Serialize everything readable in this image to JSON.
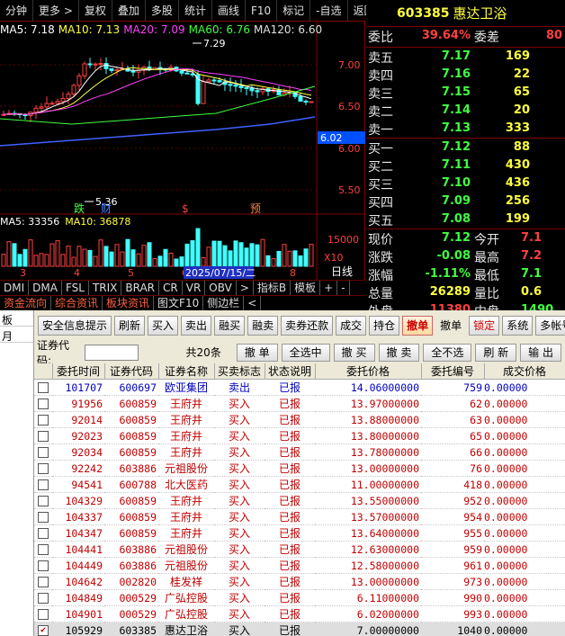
{
  "chart_toolbar": [
    "分钟",
    "更多 >",
    "复权",
    "叠加",
    "多股",
    "统计",
    "画线",
    "F10",
    "标记",
    "-自选",
    "返回"
  ],
  "ma_legend": [
    {
      "text": "MA5: 7.18",
      "color": "#ffffff"
    },
    {
      "text": "MA10: 7.13",
      "color": "#ffff40"
    },
    {
      "text": "MA20: 7.09",
      "color": "#ff40ff"
    },
    {
      "text": "MA60: 6.76",
      "color": "#40ff40"
    },
    {
      "text": "MA120: 6.60",
      "color": "#e0e0e0"
    }
  ],
  "vol_legend": [
    {
      "text": "MA5: 33356",
      "color": "#ffffff"
    },
    {
      "text": "MA10: 36878",
      "color": "#ffff40"
    }
  ],
  "chart_labels": {
    "high_marker": "7.29",
    "low_marker": "5.36",
    "price_tag": "6.02",
    "axis_ticks": [
      "7.00",
      "6.50",
      "6.00",
      "5.50"
    ],
    "vol_tick": "15000",
    "vol_unit": "X10",
    "date_tag": "2025/07/15/二",
    "day_label": "日线",
    "x_numbers": [
      "3",
      "4",
      "5",
      "6",
      "7",
      "8"
    ],
    "events": [
      {
        "text": "跌",
        "color": "#40ff40"
      },
      {
        "text": "财",
        "color": "#4080ff"
      },
      {
        "text": "$",
        "color": "#ff4040"
      },
      {
        "text": "预",
        "color": "#ff8040"
      }
    ]
  },
  "indicator_tabs": [
    "DMI",
    "DMA",
    "FSL",
    "TRIX",
    "BRAR",
    "CR",
    "VR",
    "OBV",
    ">",
    "指标B",
    "模板",
    "+",
    "-"
  ],
  "sub_tabs": [
    "资金流向",
    "综合资讯",
    "板块资讯",
    "图文F10",
    "侧边栏",
    "<"
  ],
  "quote": {
    "code": "603385",
    "name": "惠达卫浴",
    "weibi_label": "委比",
    "weibi": "39.64%",
    "weicha_label": "委差",
    "weicha": "80",
    "asks": [
      {
        "label": "卖五",
        "price": "7.17",
        "vol": "169"
      },
      {
        "label": "卖四",
        "price": "7.16",
        "vol": "22"
      },
      {
        "label": "卖三",
        "price": "7.15",
        "vol": "65"
      },
      {
        "label": "卖二",
        "price": "7.14",
        "vol": "20"
      },
      {
        "label": "卖一",
        "price": "7.13",
        "vol": "333"
      }
    ],
    "bids": [
      {
        "label": "买一",
        "price": "7.12",
        "vol": "88"
      },
      {
        "label": "买二",
        "price": "7.11",
        "vol": "430"
      },
      {
        "label": "买三",
        "price": "7.10",
        "vol": "436"
      },
      {
        "label": "买四",
        "price": "7.09",
        "vol": "256"
      },
      {
        "label": "买五",
        "price": "7.08",
        "vol": "199"
      }
    ],
    "stats": [
      {
        "l1": "现价",
        "v1": "7.12",
        "c1": "#40ff40",
        "l2": "今开",
        "v2": "7.1",
        "c2": "#ff4040"
      },
      {
        "l1": "涨跌",
        "v1": "-0.08",
        "c1": "#40ff40",
        "l2": "最高",
        "v2": "7.2",
        "c2": "#ff4040"
      },
      {
        "l1": "涨幅",
        "v1": "-1.11%",
        "c1": "#40ff40",
        "l2": "最低",
        "v2": "7.1",
        "c2": "#40ff40"
      },
      {
        "l1": "总量",
        "v1": "26289",
        "c1": "#ffff40",
        "l2": "量比",
        "v2": "0.6",
        "c2": "#ffff40"
      },
      {
        "l1": "外盘",
        "v1": "11380",
        "c1": "#ff4040",
        "l2": "内盘",
        "v2": "1490",
        "c2": "#40ff40"
      }
    ]
  },
  "left_nav": [
    "板",
    "月"
  ],
  "trade_tabs": [
    {
      "label": "安全信息提示",
      "active": false
    },
    {
      "label": "刷新",
      "active": false
    },
    {
      "label": "买入",
      "active": false
    },
    {
      "label": "卖出",
      "active": false
    },
    {
      "label": "融买",
      "active": false
    },
    {
      "label": "融卖",
      "active": false
    },
    {
      "label": "卖券还款",
      "active": false
    },
    {
      "label": "成交",
      "active": false
    },
    {
      "label": "持仓",
      "active": false
    },
    {
      "label": "撤单",
      "active": true
    },
    {
      "label": "撤单",
      "active": false,
      "plain": true
    },
    {
      "label": "锁定",
      "active": false,
      "red": true
    },
    {
      "label": "系统",
      "active": false
    },
    {
      "label": "多帐号",
      "active": false
    }
  ],
  "toolrow": {
    "code_label": "证券代码:",
    "count": "共20条",
    "buttons": [
      "撤 单",
      "全选中",
      "撤 买",
      "撤 卖",
      "全不选",
      "刷 新",
      "输 出"
    ]
  },
  "table": {
    "headers": [
      "",
      "委托时间",
      "证券代码",
      "证券名称",
      "买卖标志",
      "状态说明",
      "委托价格",
      "委托编号",
      "成交价格"
    ],
    "rows": [
      {
        "time": "101707",
        "code": "600697",
        "name": "欧亚集团",
        "side": "卖出",
        "status": "已报",
        "price": "14.06000000",
        "id": "759",
        "fill": "0.00000",
        "sell": true,
        "checked": false
      },
      {
        "time": "91956",
        "code": "600859",
        "name": "王府井",
        "side": "买入",
        "status": "已报",
        "price": "13.97000000",
        "id": "62",
        "fill": "0.00000",
        "sell": false,
        "checked": false
      },
      {
        "time": "92014",
        "code": "600859",
        "name": "王府井",
        "side": "买入",
        "status": "已报",
        "price": "13.88000000",
        "id": "63",
        "fill": "0.00000",
        "sell": false,
        "checked": false
      },
      {
        "time": "92023",
        "code": "600859",
        "name": "王府井",
        "side": "买入",
        "status": "已报",
        "price": "13.80000000",
        "id": "65",
        "fill": "0.00000",
        "sell": false,
        "checked": false
      },
      {
        "time": "92034",
        "code": "600859",
        "name": "王府井",
        "side": "买入",
        "status": "已报",
        "price": "13.78000000",
        "id": "66",
        "fill": "0.00000",
        "sell": false,
        "checked": false
      },
      {
        "time": "92242",
        "code": "603886",
        "name": "元祖股份",
        "side": "买入",
        "status": "已报",
        "price": "13.00000000",
        "id": "76",
        "fill": "0.00000",
        "sell": false,
        "checked": false
      },
      {
        "time": "94541",
        "code": "600788",
        "name": "北大医药",
        "side": "买入",
        "status": "已报",
        "price": "11.00000000",
        "id": "418",
        "fill": "0.00000",
        "sell": false,
        "checked": false
      },
      {
        "time": "104329",
        "code": "600859",
        "name": "王府井",
        "side": "买入",
        "status": "已报",
        "price": "13.55000000",
        "id": "952",
        "fill": "0.00000",
        "sell": false,
        "checked": false
      },
      {
        "time": "104337",
        "code": "600859",
        "name": "王府井",
        "side": "买入",
        "status": "已报",
        "price": "13.57000000",
        "id": "954",
        "fill": "0.00000",
        "sell": false,
        "checked": false
      },
      {
        "time": "104347",
        "code": "600859",
        "name": "王府井",
        "side": "买入",
        "status": "已报",
        "price": "13.64000000",
        "id": "955",
        "fill": "0.00000",
        "sell": false,
        "checked": false
      },
      {
        "time": "104441",
        "code": "603886",
        "name": "元祖股份",
        "side": "买入",
        "status": "已报",
        "price": "12.63000000",
        "id": "959",
        "fill": "0.00000",
        "sell": false,
        "checked": false
      },
      {
        "time": "104449",
        "code": "603886",
        "name": "元祖股份",
        "side": "买入",
        "status": "已报",
        "price": "12.58000000",
        "id": "961",
        "fill": "0.00000",
        "sell": false,
        "checked": false
      },
      {
        "time": "104642",
        "code": "002820",
        "name": "桂发祥",
        "side": "买入",
        "status": "已报",
        "price": "13.00000000",
        "id": "973",
        "fill": "0.00000",
        "sell": false,
        "checked": false
      },
      {
        "time": "104849",
        "code": "000529",
        "name": "广弘控股",
        "side": "买入",
        "status": "已报",
        "price": "6.11000000",
        "id": "990",
        "fill": "0.00000",
        "sell": false,
        "checked": false
      },
      {
        "time": "104901",
        "code": "000529",
        "name": "广弘控股",
        "side": "买入",
        "status": "已报",
        "price": "6.02000000",
        "id": "993",
        "fill": "0.00000",
        "sell": false,
        "checked": false
      },
      {
        "time": "105929",
        "code": "603385",
        "name": "惠达卫浴",
        "side": "买入",
        "status": "已报",
        "price": "7.00000000",
        "id": "1040",
        "fill": "0.00000",
        "sell": false,
        "checked": true
      }
    ]
  },
  "colors": {
    "up": "#ff4040",
    "down": "#40ff40",
    "accent": "#ffff40",
    "sell_text": "#0000c0",
    "buy_text": "#c00000"
  }
}
